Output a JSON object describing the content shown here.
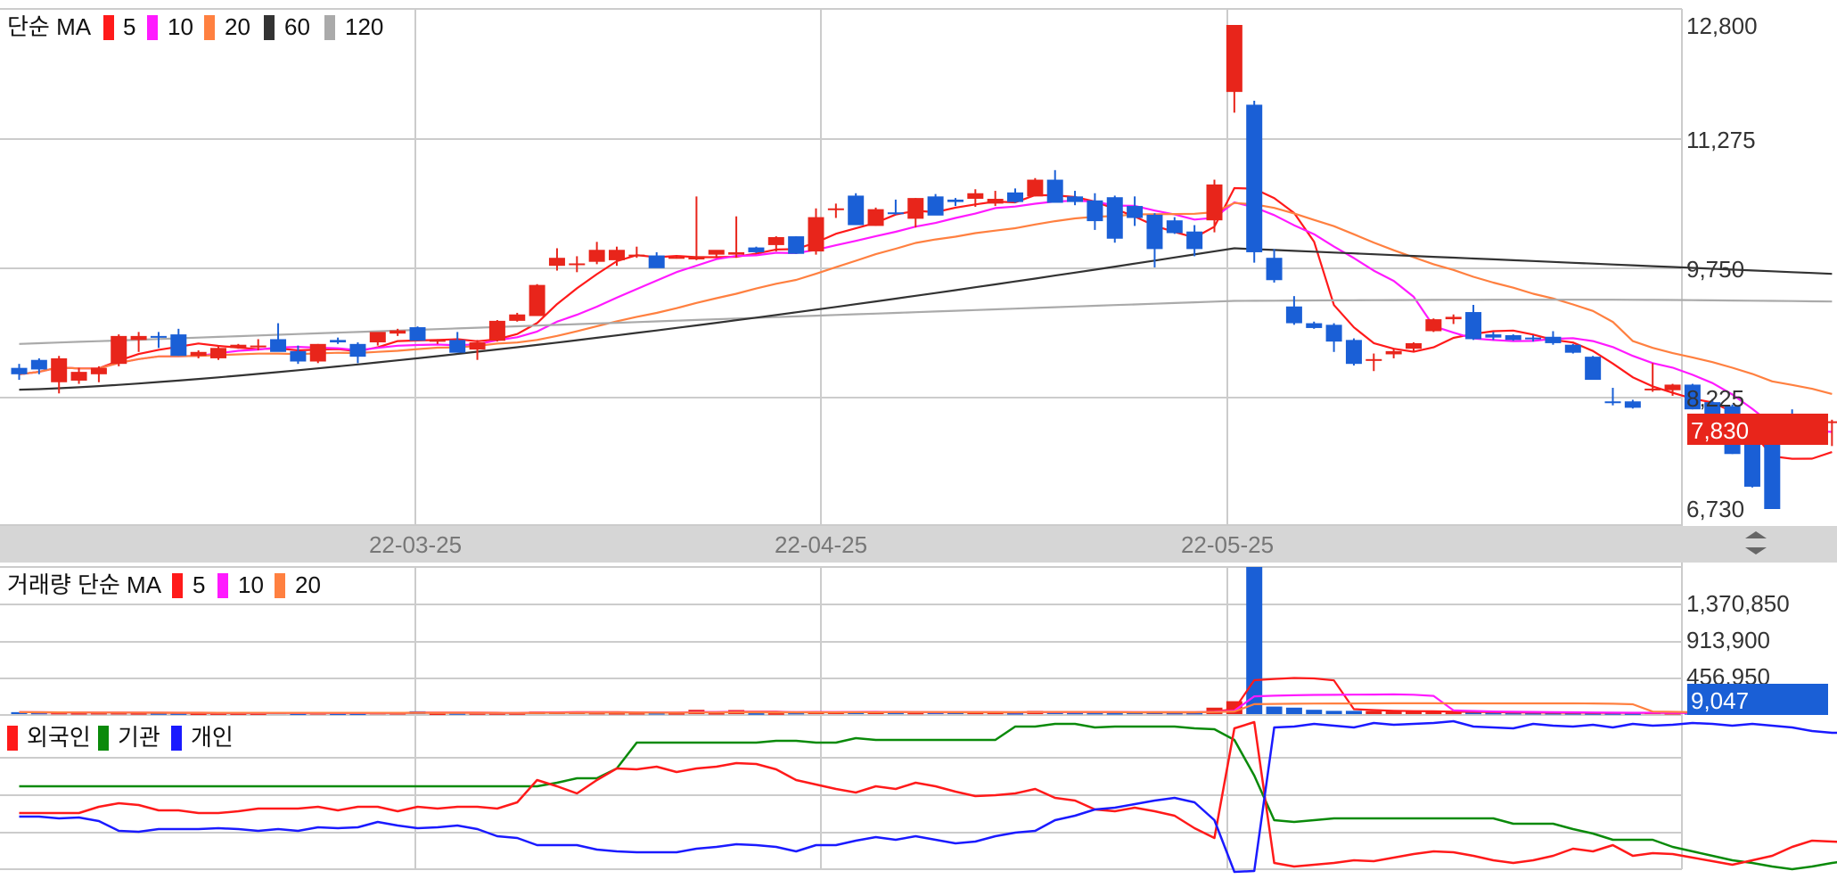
{
  "price_panel": {
    "legend": {
      "label": "단순 MA",
      "items": [
        {
          "label": "5",
          "color": "#ff1a1a"
        },
        {
          "label": "10",
          "color": "#ff1aff"
        },
        {
          "label": "20",
          "color": "#ff8040"
        },
        {
          "label": "60",
          "color": "#333333"
        },
        {
          "label": "120",
          "color": "#aaaaaa"
        }
      ]
    },
    "y_ticks": [
      "12,800",
      "11,275",
      "9,750",
      "8,225",
      "6,730"
    ],
    "current_price": "7,830",
    "current_price_color": "#e8251b"
  },
  "date_axis": {
    "labels": [
      "22-03-25",
      "22-04-25",
      "22-05-25"
    ]
  },
  "volume_panel": {
    "legend": {
      "label": "거래량 단순 MA",
      "items": [
        {
          "label": "5",
          "color": "#ff1a1a"
        },
        {
          "label": "10",
          "color": "#ff1aff"
        },
        {
          "label": "20",
          "color": "#ff8040"
        }
      ]
    },
    "y_ticks": [
      "1,370,850",
      "913,900",
      "456,950"
    ],
    "current_volume": "9,047",
    "current_volume_color": "#1a5fd6"
  },
  "investor_panel": {
    "legend": [
      {
        "label": "외국인",
        "color": "#ff1a1a"
      },
      {
        "label": "기관",
        "color": "#0a8a0a"
      },
      {
        "label": "개인",
        "color": "#1a1aff"
      }
    ]
  },
  "colors": {
    "up": "#e8251b",
    "down": "#1a5fd6",
    "grid": "#cccccc"
  },
  "chart_data": {
    "type": "candlestick",
    "title": "",
    "x_tick_labels": [
      "22-03-25",
      "22-04-25",
      "22-05-25"
    ],
    "ylim": [
      6730,
      12800
    ],
    "candles": [
      [
        8500,
        8550,
        8350,
        8420
      ],
      [
        8600,
        8620,
        8420,
        8480
      ],
      [
        8320,
        8650,
        8180,
        8620
      ],
      [
        8340,
        8500,
        8300,
        8450
      ],
      [
        8420,
        8520,
        8320,
        8500
      ],
      [
        8550,
        8920,
        8520,
        8900
      ],
      [
        8850,
        8950,
        8700,
        8900
      ],
      [
        8900,
        8950,
        8750,
        8880
      ],
      [
        8920,
        8990,
        8650,
        8650
      ],
      [
        8650,
        8720,
        8620,
        8700
      ],
      [
        8620,
        8780,
        8600,
        8750
      ],
      [
        8750,
        8800,
        8740,
        8790
      ],
      [
        8770,
        8860,
        8720,
        8780
      ],
      [
        8860,
        9060,
        8720,
        8700
      ],
      [
        8710,
        8780,
        8550,
        8580
      ],
      [
        8580,
        8800,
        8560,
        8800
      ],
      [
        8850,
        8880,
        8800,
        8820
      ],
      [
        8800,
        8820,
        8560,
        8640
      ],
      [
        8820,
        8940,
        8780,
        8950
      ],
      [
        8930,
        8990,
        8900,
        8970
      ],
      [
        9010,
        9020,
        8850,
        8840
      ],
      [
        8830,
        8860,
        8800,
        8850
      ],
      [
        8850,
        8950,
        8720,
        8690
      ],
      [
        8730,
        8850,
        8600,
        8820
      ],
      [
        8840,
        9100,
        8830,
        9090
      ],
      [
        9090,
        9190,
        9080,
        9170
      ],
      [
        9150,
        9550,
        9150,
        9540
      ],
      [
        9780,
        10000,
        9720,
        9880
      ],
      [
        9800,
        9900,
        9700,
        9810
      ],
      [
        9830,
        10080,
        9800,
        9980
      ],
      [
        9850,
        10020,
        9780,
        9980
      ],
      [
        9900,
        10020,
        9880,
        9920
      ],
      [
        9910,
        9950,
        9760,
        9750
      ],
      [
        9890,
        9910,
        9870,
        9890
      ],
      [
        9860,
        10650,
        9850,
        9900
      ],
      [
        9920,
        9950,
        9880,
        9980
      ],
      [
        9920,
        10400,
        9880,
        9950
      ],
      [
        10010,
        10020,
        9940,
        9950
      ],
      [
        10040,
        10150,
        9960,
        10140
      ],
      [
        10150,
        10150,
        9930,
        9930
      ],
      [
        9960,
        10500,
        9920,
        10390
      ],
      [
        10500,
        10560,
        10380,
        10500
      ],
      [
        10660,
        10690,
        10360,
        10290
      ],
      [
        10280,
        10510,
        10280,
        10490
      ],
      [
        10450,
        10610,
        10420,
        10440
      ],
      [
        10370,
        10630,
        10260,
        10630
      ],
      [
        10650,
        10680,
        10440,
        10410
      ],
      [
        10610,
        10630,
        10530,
        10580
      ],
      [
        10620,
        10740,
        10520,
        10690
      ],
      [
        10560,
        10720,
        10530,
        10620
      ],
      [
        10700,
        10750,
        10570,
        10580
      ],
      [
        10650,
        10880,
        10650,
        10860
      ],
      [
        10860,
        10980,
        10600,
        10570
      ],
      [
        10650,
        10720,
        10540,
        10580
      ],
      [
        10600,
        10690,
        10230,
        10340
      ],
      [
        10640,
        10660,
        10070,
        10120
      ],
      [
        10530,
        10650,
        10280,
        10380
      ],
      [
        10420,
        10440,
        9760,
        9990
      ],
      [
        10350,
        10390,
        10180,
        10190
      ],
      [
        10210,
        10290,
        9900,
        9990
      ],
      [
        10350,
        10860,
        10200,
        10800
      ],
      [
        11960,
        12800,
        11700,
        12800
      ],
      [
        11800,
        11850,
        9820,
        9950
      ],
      [
        9880,
        9990,
        9570,
        9600
      ],
      [
        9270,
        9400,
        9040,
        9060
      ],
      [
        9060,
        9080,
        8990,
        9000
      ],
      [
        9040,
        9060,
        8700,
        8830
      ],
      [
        8850,
        8870,
        8530,
        8550
      ],
      [
        8600,
        8680,
        8460,
        8610
      ],
      [
        8670,
        8740,
        8620,
        8710
      ],
      [
        8740,
        8820,
        8700,
        8810
      ],
      [
        8960,
        9120,
        8950,
        9110
      ],
      [
        9110,
        9170,
        9050,
        9140
      ],
      [
        9200,
        9290,
        8850,
        8860
      ],
      [
        8920,
        8950,
        8850,
        8880
      ],
      [
        8910,
        8920,
        8840,
        8850
      ],
      [
        8880,
        8910,
        8830,
        8860
      ],
      [
        8890,
        8960,
        8790,
        8810
      ],
      [
        8790,
        8800,
        8680,
        8690
      ],
      [
        8640,
        8650,
        8360,
        8350
      ],
      [
        8080,
        8250,
        8030,
        8060
      ],
      [
        8080,
        8100,
        7990,
        8000
      ],
      [
        8220,
        8560,
        8200,
        8240
      ],
      [
        8220,
        8300,
        8150,
        8290
      ],
      [
        8290,
        8300,
        7980,
        7980
      ],
      [
        8070,
        8110,
        7820,
        7820
      ],
      [
        8020,
        8040,
        7420,
        7420
      ],
      [
        7540,
        7570,
        7000,
        7010
      ],
      [
        7710,
        7730,
        6730,
        6730
      ],
      [
        7830,
        7980,
        7780,
        7820
      ],
      [
        7830,
        7880,
        7740,
        7830
      ],
      [
        7820,
        7850,
        7520,
        7830
      ]
    ],
    "volume": [
      18000,
      15000,
      14000,
      12000,
      13000,
      13000,
      11000,
      10000,
      9000,
      8000,
      9000,
      9000,
      9000,
      16000,
      8000,
      12000,
      8000,
      8000,
      14000,
      12000,
      26000,
      8000,
      10000,
      10000,
      10000,
      10000,
      24000,
      24000,
      18000,
      14000,
      12000,
      12000,
      12000,
      11000,
      40000,
      12000,
      38000,
      10000,
      10000,
      14000,
      22000,
      22000,
      20000,
      18000,
      16000,
      15000,
      18000,
      17000,
      16000,
      16000,
      12000,
      30000,
      26000,
      15000,
      14000,
      12000,
      16000,
      18000,
      14000,
      14000,
      60000,
      120000,
      1370850,
      70000,
      60000,
      40000,
      30000,
      30000,
      28000,
      26000,
      24000,
      20000,
      16000,
      16000,
      14000,
      13000,
      12000,
      12000,
      11000,
      10000,
      10000,
      9000,
      16000,
      12000,
      11000,
      10000,
      10000,
      9000,
      9500,
      9000,
      9047
    ]
  }
}
